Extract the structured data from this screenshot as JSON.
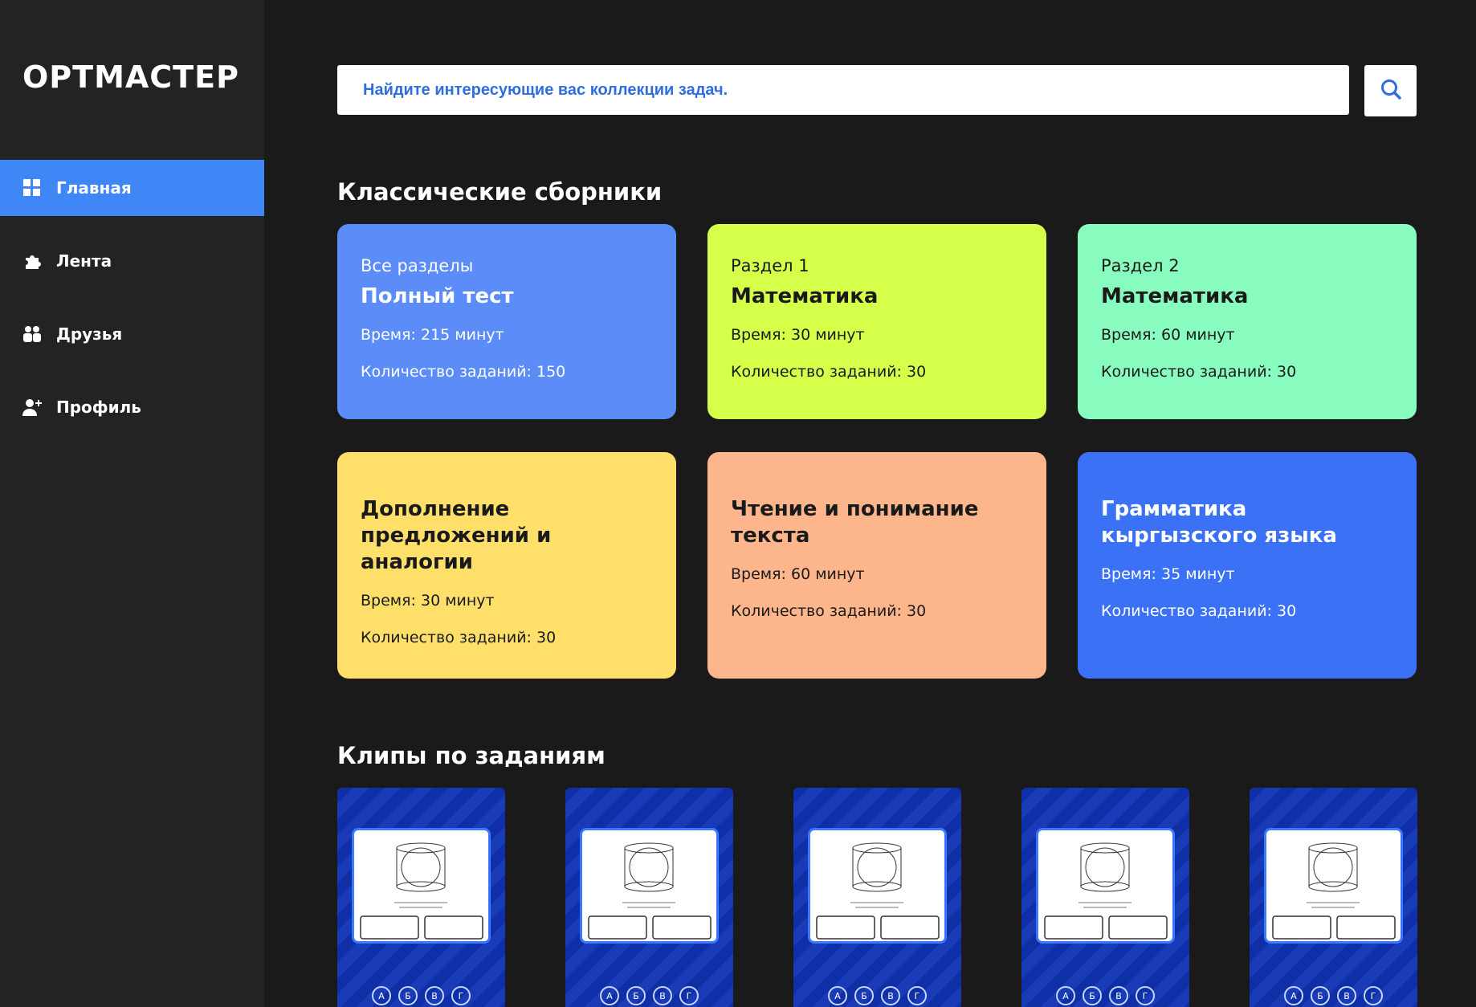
{
  "app": {
    "logo": "ОРТМАСТЕР"
  },
  "sidebar": {
    "items": [
      {
        "label": "Главная",
        "icon": "grid-icon",
        "active": true
      },
      {
        "label": "Лента",
        "icon": "puzzle-icon",
        "active": false
      },
      {
        "label": "Друзья",
        "icon": "users-icon",
        "active": false
      },
      {
        "label": "Профиль",
        "icon": "user-plus-icon",
        "active": false
      }
    ]
  },
  "search": {
    "placeholder": "Найдите интересующие вас коллекции задач.",
    "button_icon": "search-icon"
  },
  "sections": {
    "classic_title": "Классические сборники",
    "clips_title": "Клипы по заданиям"
  },
  "cards": [
    {
      "subtitle": "Все разделы",
      "title": "Полный тест",
      "time": "Время: 215 минут",
      "count": "Количество заданий: 150",
      "bg": "#5b8cf7",
      "color": "#ffffff"
    },
    {
      "subtitle": "Раздел 1",
      "title": "Математика",
      "time": "Время: 30 минут",
      "count": "Количество заданий: 30",
      "bg": "#d6ff4a",
      "color": "#1a1a1a"
    },
    {
      "subtitle": "Раздел 2",
      "title": "Математика",
      "time": "Время: 60 минут",
      "count": "Количество заданий: 30",
      "bg": "#88fbbf",
      "color": "#1a1a1a"
    },
    {
      "title": "Дополнение предложений и аналогии",
      "time": "Время: 30 минут",
      "count": "Количество заданий: 30",
      "bg": "#fddf6a",
      "color": "#1a1a1a"
    },
    {
      "title": "Чтение и понимание текста",
      "time": "Время: 60 минут",
      "count": "Количество заданий: 30",
      "bg": "#fdb68b",
      "color": "#1a1a1a"
    },
    {
      "title": "Грамматика кыргызского языка",
      "time": "Время: 35 минут",
      "count": "Количество заданий: 30",
      "bg": "#3b71f5",
      "color": "#ffffff"
    }
  ],
  "clips": [
    {
      "options": [
        "А",
        "Б",
        "В",
        "Г"
      ]
    },
    {
      "options": [
        "А",
        "Б",
        "В",
        "Г"
      ]
    },
    {
      "options": [
        "А",
        "Б",
        "В",
        "Г"
      ]
    },
    {
      "options": [
        "А",
        "Б",
        "В",
        "Г"
      ]
    },
    {
      "options": [
        "А",
        "Б",
        "В",
        "Г"
      ]
    }
  ]
}
